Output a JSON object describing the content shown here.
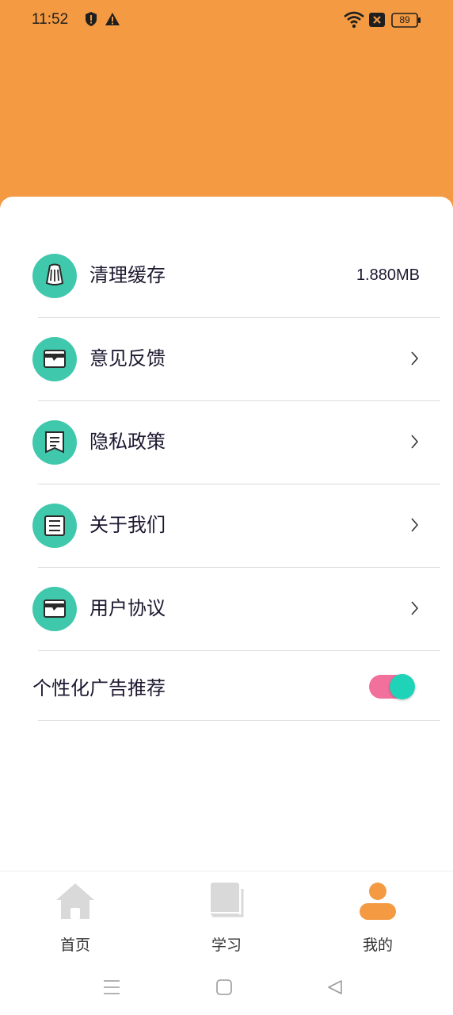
{
  "status_bar": {
    "time": "11:52",
    "battery": "89",
    "icons": [
      "shield-alert-icon",
      "warning-icon",
      "wifi-icon",
      "close-box-icon",
      "battery-icon"
    ]
  },
  "colors": {
    "header": "#f39a43",
    "icon_bg": "#40c8ad",
    "toggle_track": "#f2709c",
    "toggle_knob": "#1ed3b7",
    "tab_active": "#f39a43",
    "tab_inactive": "#d9d9d9"
  },
  "menu": {
    "items": [
      {
        "icon": "broom-icon",
        "label": "清理缓存",
        "value": "1.880MB"
      },
      {
        "icon": "feedback-icon",
        "label": "意见反馈"
      },
      {
        "icon": "privacy-document-icon",
        "label": "隐私政策"
      },
      {
        "icon": "about-document-icon",
        "label": "关于我们"
      },
      {
        "icon": "agreement-icon",
        "label": "用户协议"
      }
    ],
    "toggle": {
      "label": "个性化广告推荐",
      "on": true
    }
  },
  "tab_bar": {
    "tabs": [
      {
        "icon": "home-icon",
        "label": "首页",
        "active": false
      },
      {
        "icon": "book-icon",
        "label": "学习",
        "active": false
      },
      {
        "icon": "person-icon",
        "label": "我的",
        "active": true
      }
    ]
  },
  "nav_bar": {
    "buttons": [
      "menu-icon",
      "home-square-icon",
      "back-triangle-icon"
    ]
  }
}
